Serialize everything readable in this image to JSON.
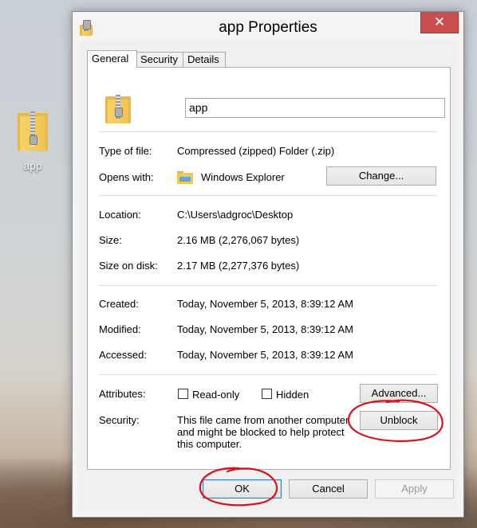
{
  "desktop": {
    "icon_label": "app"
  },
  "window": {
    "title": "app Properties",
    "close_glyph": "✕"
  },
  "tabs": [
    {
      "label": "General"
    },
    {
      "label": "Security"
    },
    {
      "label": "Details"
    }
  ],
  "general": {
    "name_value": "app",
    "type_label": "Type of file:",
    "type_value": "Compressed (zipped) Folder (.zip)",
    "opens_label": "Opens with:",
    "opens_value": "Windows Explorer",
    "change_button": "Change...",
    "location_label": "Location:",
    "location_value": "C:\\Users\\adgroc\\Desktop",
    "size_label": "Size:",
    "size_value": "2.16 MB (2,276,067 bytes)",
    "size_on_disk_label": "Size on disk:",
    "size_on_disk_value": "2.17 MB (2,277,376 bytes)",
    "created_label": "Created:",
    "created_value": "Today, November 5, 2013, 8:39:12 AM",
    "modified_label": "Modified:",
    "modified_value": "Today, November 5, 2013, 8:39:12 AM",
    "accessed_label": "Accessed:",
    "accessed_value": "Today, November 5, 2013, 8:39:12 AM",
    "attributes_label": "Attributes:",
    "readonly_label": "Read-only",
    "readonly_checked": false,
    "hidden_label": "Hidden",
    "hidden_checked": false,
    "advanced_button": "Advanced...",
    "security_label": "Security:",
    "security_line1": "This file came from another computer",
    "security_line2": "and might be blocked to help protect",
    "security_line3": "this computer.",
    "unblock_button": "Unblock"
  },
  "footer": {
    "ok_button": "OK",
    "cancel_button": "Cancel",
    "apply_button": "Apply"
  },
  "colors": {
    "close_button": "#c74f4f",
    "annotation_red": "#d8141b"
  }
}
